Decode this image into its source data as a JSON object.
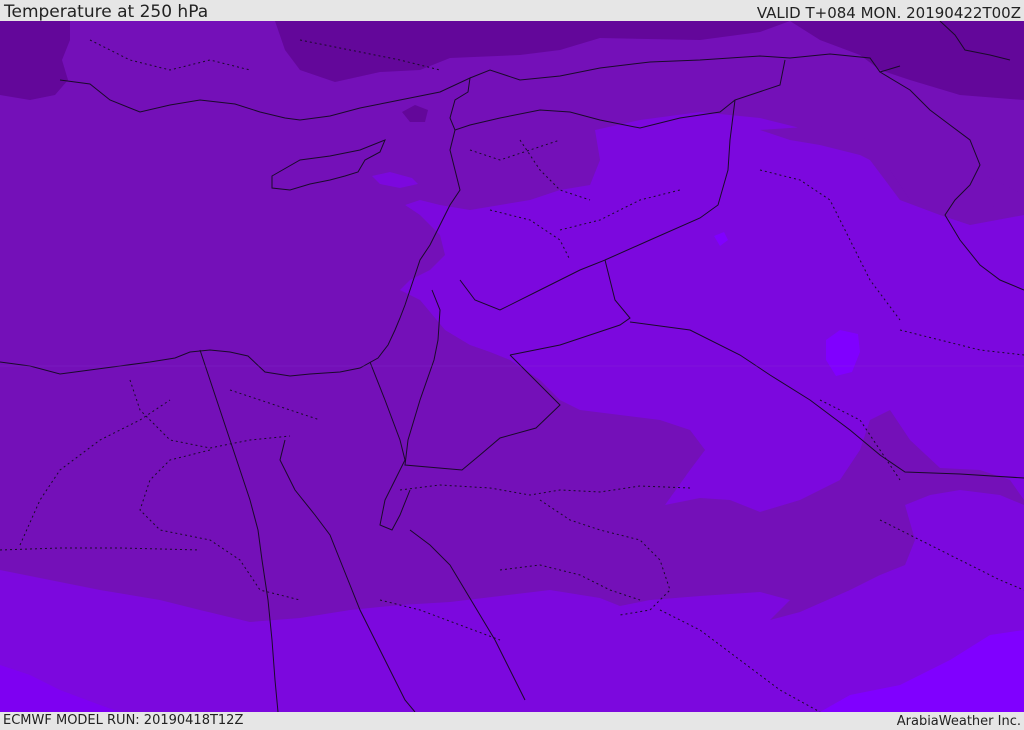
{
  "header": {
    "title": "Temperature at 250 hPa",
    "valid": "VALID T+084 MON. 20190422T00Z"
  },
  "footer": {
    "model_run": "ECMWF MODEL RUN: 20190418T12Z",
    "credit": "ArabiaWeather Inc."
  },
  "map": {
    "colors": {
      "dark": "#63079a",
      "mid": "#7410b8",
      "light": "#7c08de",
      "lighter": "#7e00f2",
      "brightest": "#8000ff",
      "border": "#1a0a2a"
    }
  }
}
